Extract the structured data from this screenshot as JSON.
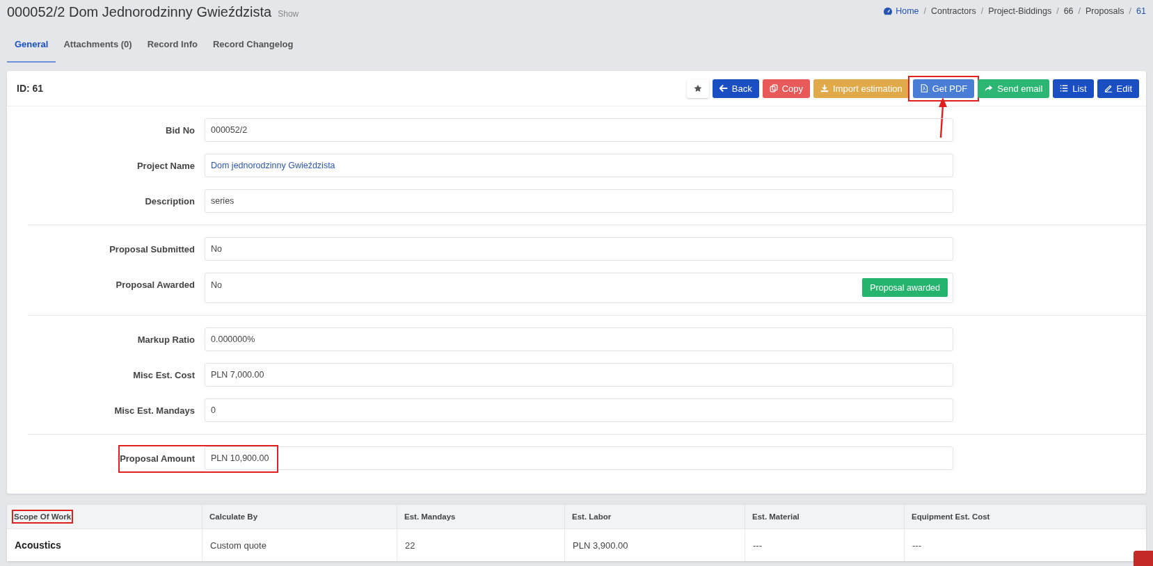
{
  "page": {
    "title": "000052/2 Dom Jednorodzinny Gwieździsta",
    "subtitle": "Show"
  },
  "breadcrumb": [
    {
      "label": "Home",
      "kind": "home",
      "link": true
    },
    {
      "label": "Contractors",
      "kind": "plain",
      "link": false,
      "separator": "/"
    },
    {
      "label": "Project-Biddings",
      "kind": "plain",
      "link": false,
      "separator": "/"
    },
    {
      "label": "66",
      "kind": "plain",
      "link": false,
      "separator": "/"
    },
    {
      "label": "Proposals",
      "kind": "plain",
      "link": false,
      "separator": "/"
    },
    {
      "label": "61",
      "kind": "plain",
      "link": true,
      "separator": "/"
    }
  ],
  "tabs": [
    {
      "label": "General",
      "selected": true
    },
    {
      "label": "Attachments (0)",
      "selected": false
    },
    {
      "label": "Record Info",
      "selected": false
    },
    {
      "label": "Record Changelog",
      "selected": false
    }
  ],
  "card": {
    "title": "ID: 61",
    "buttons": [
      {
        "kind": "star",
        "highlighted": false,
        "arrow": false
      },
      {
        "kind": "back",
        "label": "Back",
        "highlighted": false,
        "arrow": false
      },
      {
        "kind": "copy",
        "label": "Copy",
        "highlighted": false,
        "arrow": false
      },
      {
        "kind": "import",
        "label": "Import estimation",
        "highlighted": false,
        "arrow": false
      },
      {
        "kind": "pdf",
        "label": "Get PDF",
        "highlighted": true,
        "arrow": true
      },
      {
        "kind": "email",
        "label": "Send email",
        "highlighted": false,
        "arrow": false
      },
      {
        "kind": "list",
        "label": "List",
        "highlighted": false,
        "arrow": false
      },
      {
        "kind": "edit",
        "label": "Edit",
        "highlighted": false,
        "arrow": false
      }
    ],
    "fields": [
      {
        "kind": "field",
        "label": "Bid No",
        "value": "000052/2",
        "link": false,
        "highlighted": false
      },
      {
        "kind": "field",
        "label": "Project Name",
        "value": "Dom jednorodzinny Gwieździsta",
        "link": true,
        "highlighted": false
      },
      {
        "kind": "field",
        "label": "Description",
        "value": "series",
        "link": false,
        "highlighted": false
      },
      {
        "kind": "divider"
      },
      {
        "kind": "field",
        "label": "Proposal Submitted",
        "value": "No",
        "link": false,
        "highlighted": false
      },
      {
        "kind": "field",
        "label": "Proposal Awarded",
        "value": "No",
        "link": false,
        "highlighted": false,
        "action": "Proposal awarded"
      },
      {
        "kind": "divider"
      },
      {
        "kind": "field",
        "label": "Markup Ratio",
        "value": "0.000000%",
        "link": false,
        "highlighted": false
      },
      {
        "kind": "field",
        "label": "Misc Est. Cost",
        "value": "PLN 7,000.00",
        "link": false,
        "highlighted": false
      },
      {
        "kind": "field",
        "label": "Misc Est. Mandays",
        "value": "0",
        "link": false,
        "highlighted": false
      },
      {
        "kind": "divider"
      },
      {
        "kind": "field",
        "label": "Proposal Amount",
        "value": "PLN 10,900.00",
        "link": false,
        "highlighted": true
      }
    ]
  },
  "table": {
    "columns": [
      {
        "label": "Scope Of Work",
        "highlighted": true
      },
      {
        "label": "Calculate By",
        "highlighted": false
      },
      {
        "label": "Est. Mandays",
        "highlighted": false
      },
      {
        "label": "Est. Labor",
        "highlighted": false
      },
      {
        "label": "Est. Material",
        "highlighted": false
      },
      {
        "label": "Equipment Est. Cost",
        "highlighted": false
      }
    ],
    "rows": [
      [
        "Acoustics",
        "Custom quote",
        "22",
        "PLN 3,900.00",
        "---",
        "---"
      ]
    ]
  }
}
